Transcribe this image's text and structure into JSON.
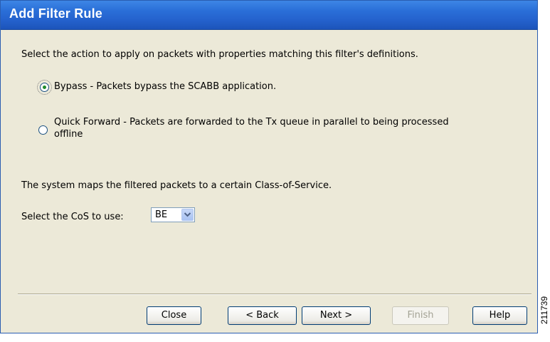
{
  "window": {
    "title": "Add Filter Rule"
  },
  "main": {
    "instruction": "Select the action to apply on packets with properties matching this filter's definitions.",
    "options": [
      {
        "label": "Bypass - Packets bypass the SCABB application.",
        "selected": true
      },
      {
        "label_line1": "Quick Forward - Packets are forwarded to the Tx queue in parallel to being processed",
        "label_line2": "offline",
        "selected": false
      }
    ],
    "cos_info": "The system maps the filtered packets to a certain Class-of-Service.",
    "cos_label": "Select the CoS to use:",
    "cos_value": "BE"
  },
  "buttons": {
    "close": "Close",
    "back": "< Back",
    "next": "Next >",
    "finish": "Finish",
    "help": "Help"
  },
  "figure_id": "211739"
}
